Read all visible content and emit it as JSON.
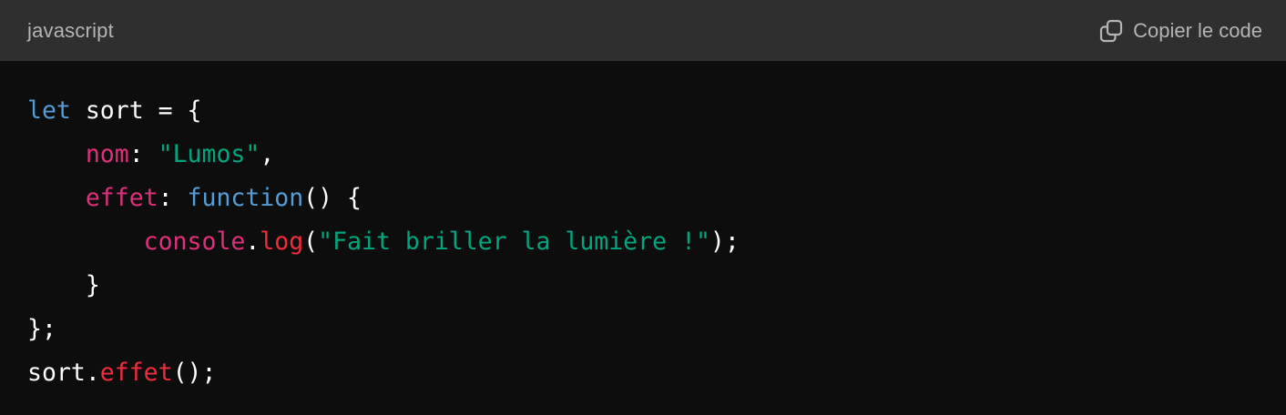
{
  "header": {
    "language": "javascript",
    "copy_label": "Copier le code",
    "copy_icon": "copy-icon"
  },
  "colors": {
    "header_bg": "#2f2f2f",
    "code_bg": "#0d0d0d",
    "keyword": "#569cd6",
    "property": "#df3079",
    "string": "#00a67d",
    "method": "#f22c3d",
    "plain": "#ffffff"
  },
  "code": {
    "lines": [
      [
        {
          "t": "let",
          "c": "keyword"
        },
        {
          "t": " sort = {",
          "c": "plain"
        }
      ],
      [
        {
          "t": "    ",
          "c": "plain"
        },
        {
          "t": "nom",
          "c": "prop"
        },
        {
          "t": ": ",
          "c": "plain"
        },
        {
          "t": "\"Lumos\"",
          "c": "string"
        },
        {
          "t": ",",
          "c": "plain"
        }
      ],
      [
        {
          "t": "    ",
          "c": "plain"
        },
        {
          "t": "effet",
          "c": "prop"
        },
        {
          "t": ": ",
          "c": "plain"
        },
        {
          "t": "function",
          "c": "keyword"
        },
        {
          "t": "() {",
          "c": "plain"
        }
      ],
      [
        {
          "t": "        ",
          "c": "plain"
        },
        {
          "t": "console",
          "c": "prop"
        },
        {
          "t": ".",
          "c": "plain"
        },
        {
          "t": "log",
          "c": "method"
        },
        {
          "t": "(",
          "c": "plain"
        },
        {
          "t": "\"Fait briller la lumière !\"",
          "c": "string"
        },
        {
          "t": ");",
          "c": "plain"
        }
      ],
      [
        {
          "t": "    }",
          "c": "plain"
        }
      ],
      [
        {
          "t": "};",
          "c": "plain"
        }
      ],
      [
        {
          "t": "sort.",
          "c": "plain"
        },
        {
          "t": "effet",
          "c": "method"
        },
        {
          "t": "();",
          "c": "plain"
        }
      ]
    ]
  }
}
